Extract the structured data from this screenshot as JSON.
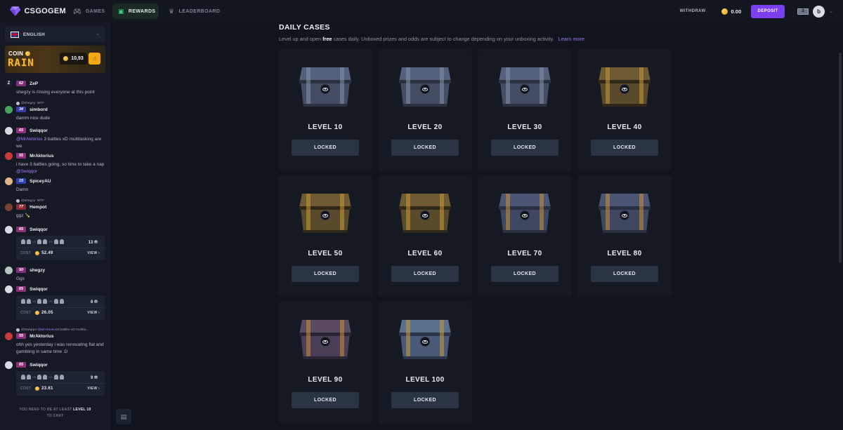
{
  "header": {
    "logo": "CSGOGEM",
    "nav": [
      {
        "label": "GAMES",
        "icon": "gamepad-icon"
      },
      {
        "label": "REWARDS",
        "icon": "gift-icon"
      },
      {
        "label": "LEADERBOARD",
        "icon": "trophy-icon"
      }
    ],
    "withdraw_label": "WITHDRAW",
    "balance": "0.00",
    "deposit_label": "DEPOSIT",
    "notification_count": "2",
    "avatar_initial": "b"
  },
  "sidebar": {
    "language": "ENGLISH",
    "rain": {
      "coin_label": "COIN",
      "rain_label": "RAIN",
      "amount": "10,93"
    },
    "messages": [
      {
        "avatar": "Z",
        "avatar_color": "#1b1f29",
        "level": "62",
        "level_color": "#a63aa0",
        "name": "ZeP",
        "text": "shegzy is rinsing everyone at this point"
      },
      {
        "reply_user": "@shegzy:",
        "reply_text": "WTF",
        "avatar": "",
        "avatar_color": "#4aa35b",
        "level": "34",
        "level_color": "#3a3aa8",
        "name": "simbord",
        "text": "damm nice dude"
      },
      {
        "avatar": "",
        "avatar_color": "#d7dbe3",
        "level": "65",
        "level_color": "#a63a8e",
        "name": "Swiqqor",
        "mention": "@MrAktorius",
        "text": " 3 battles xD multitasking are we"
      },
      {
        "avatar": "",
        "avatar_color": "#c93a3a",
        "level": "55",
        "level_color": "#a63a8e",
        "name": "MrAktorius",
        "text": "i have 3 battles going, so time to take a nap ",
        "mention_after": "@Swiqqor"
      },
      {
        "avatar": "",
        "avatar_color": "#e3b38a",
        "level": "15",
        "level_color": "#2f3fb8",
        "name": "SpiceyAU",
        "text": "Damn"
      },
      {
        "reply_user": "@shegzy:",
        "reply_text": "WTF",
        "avatar": "",
        "avatar_color": "#7a4030",
        "level": "77",
        "level_color": "#a8323c",
        "name": "Hempot",
        "text": "ggz 🍾"
      },
      {
        "avatar": "",
        "avatar_color": "#d7dbe3",
        "level": "65",
        "level_color": "#a63a8e",
        "name": "Swiqqor",
        "battle": {
          "count": "13",
          "cost": "52.49"
        }
      },
      {
        "avatar": "",
        "avatar_color": "#b9c7c2",
        "level": "50",
        "level_color": "#a63aa0",
        "name": "shegzy",
        "text": "Ggs"
      },
      {
        "avatar": "",
        "avatar_color": "#d7dbe3",
        "level": "65",
        "level_color": "#a63a8e",
        "name": "Swiqqor",
        "battle": {
          "count": "6",
          "cost": "26.05"
        }
      },
      {
        "reply_user": "@Swiqqor:",
        "reply_mention": "@MrAktorius",
        "reply_text": " 3 battles xD multita...",
        "avatar": "",
        "avatar_color": "#c93a3a",
        "level": "55",
        "level_color": "#a63a8e",
        "name": "MrAktorius",
        "text": "ohh yes yesterday i was renovating flat and gambling in same time :D"
      },
      {
        "avatar": "",
        "avatar_color": "#d7dbe3",
        "level": "65",
        "level_color": "#a63a8e",
        "name": "Swiqqor",
        "battle": {
          "count": "9",
          "cost": "23.61"
        }
      }
    ],
    "battle_labels": {
      "cost": "COST",
      "view": "VIEW"
    },
    "chat_notice": {
      "prefix": "YOU NEED TO BE AT LEAST",
      "level": "LEVEL 10",
      "suffix": "TO CHAT"
    }
  },
  "main": {
    "title": "DAILY CASES",
    "subtitle_pre": "Level up and open",
    "subtitle_free": "free",
    "subtitle_post": "cases daily. Unboxed prizes and odds are subject to change depending on your unboxing activity.",
    "learn_more": "Learn more",
    "cases": [
      {
        "title": "LEVEL 10",
        "button": "LOCKED",
        "style": "steel"
      },
      {
        "title": "LEVEL 20",
        "button": "LOCKED",
        "style": "steel"
      },
      {
        "title": "LEVEL 30",
        "button": "LOCKED",
        "style": "steel"
      },
      {
        "title": "LEVEL 40",
        "button": "LOCKED",
        "style": "gold"
      },
      {
        "title": "LEVEL 50",
        "button": "LOCKED",
        "style": "gold"
      },
      {
        "title": "LEVEL 60",
        "button": "LOCKED",
        "style": "gold"
      },
      {
        "title": "LEVEL 70",
        "button": "LOCKED",
        "style": "blue"
      },
      {
        "title": "LEVEL 80",
        "button": "LOCKED",
        "style": "blue"
      },
      {
        "title": "LEVEL 90",
        "button": "LOCKED",
        "style": "purple"
      },
      {
        "title": "LEVEL 100",
        "button": "LOCKED",
        "style": "sky"
      }
    ]
  }
}
